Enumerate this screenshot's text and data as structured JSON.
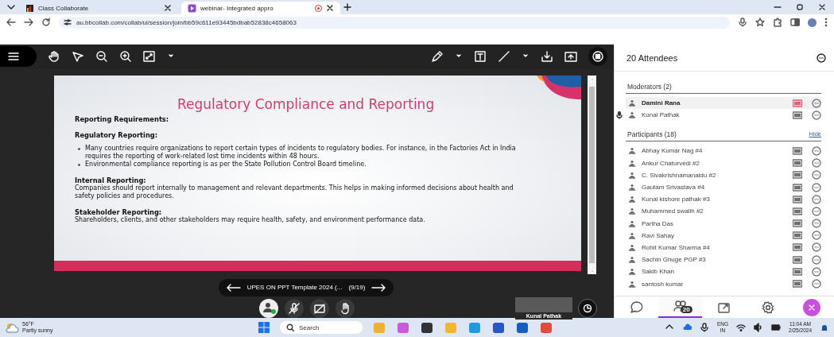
{
  "browser": {
    "tabs": [
      {
        "title": "Class Collaborate",
        "selected": false,
        "recording": false
      },
      {
        "title": "webinar- Integrated appro",
        "selected": true,
        "recording": true
      }
    ],
    "url": "au.bbcollab.com/collab/ui/session/join/bb59c611e93445bdbab52838c4658063"
  },
  "slide": {
    "title": "Regulatory Compliance and Reporting",
    "blocks": [
      {
        "kind": "heading",
        "text": "Reporting Requirements:"
      },
      {
        "kind": "heading",
        "text": "Regulatory Reporting:"
      },
      {
        "kind": "bullet",
        "text": "Many countries require organizations to report certain types of incidents to regulatory bodies. For instance, in the Factories Act in India requires the reporting of work-related lost time incidents within 48 hours."
      },
      {
        "kind": "bullet",
        "text": "Environmental compliance reporting is as per the State Pollution Control Board timeline."
      },
      {
        "kind": "heading",
        "text": "Internal Reporting:"
      },
      {
        "kind": "paragraph",
        "text": "Companies should report internally to management and relevant departments. This helps in making informed decisions about health and safety policies and procedures."
      },
      {
        "kind": "heading",
        "text": "Stakeholder Reporting:"
      },
      {
        "kind": "paragraph",
        "text": "Shareholders, clients, and other stakeholders may require health, safety, and environment performance data."
      }
    ]
  },
  "slide_nav": {
    "file": "UPES ON PPT Template 2024 (...",
    "page": "(9/19)"
  },
  "video_tile": {
    "name": "Kunal Pathak"
  },
  "attendees": {
    "title": "20 Attendees",
    "groups": [
      {
        "label": "Moderators (2)",
        "people": [
          {
            "name": "Damini Rana",
            "highlighted": true,
            "talking": false,
            "color": "#e06070"
          },
          {
            "name": "Kunal Pathak",
            "highlighted": false,
            "talking": true,
            "color": "#707070"
          }
        ]
      },
      {
        "label": "Participants (18)",
        "action": "Hide",
        "people": [
          {
            "name": "Abhay Kumar Nag #4",
            "highlighted": false,
            "talking": false,
            "color": "#707070"
          },
          {
            "name": "Ankur Chaturvedi #2",
            "highlighted": false,
            "talking": false,
            "color": "#707070"
          },
          {
            "name": "C. Sivakrishnamanaidu #2",
            "highlighted": false,
            "talking": false,
            "color": "#707070"
          },
          {
            "name": "Gautam Srivastava #4",
            "highlighted": false,
            "talking": false,
            "color": "#707070"
          },
          {
            "name": "Kunal kishore pathak #3",
            "highlighted": false,
            "talking": false,
            "color": "#707070"
          },
          {
            "name": "Muhammed swalih #2",
            "highlighted": false,
            "talking": false,
            "color": "#707070"
          },
          {
            "name": "Partha Das",
            "highlighted": false,
            "talking": false,
            "color": "#707070"
          },
          {
            "name": "Ravi Sahay",
            "highlighted": false,
            "talking": false,
            "color": "#707070"
          },
          {
            "name": "Rohit Kumar Sharma #4",
            "highlighted": false,
            "talking": false,
            "color": "#707070"
          },
          {
            "name": "Sachin Ghuge PGP #3",
            "highlighted": false,
            "talking": false,
            "color": "#707070"
          },
          {
            "name": "Sakib Khan",
            "highlighted": false,
            "talking": false,
            "color": "#707070"
          },
          {
            "name": "santosh kumar",
            "highlighted": false,
            "talking": false,
            "color": "#707070"
          }
        ]
      }
    ]
  },
  "panel_tabs": [
    {
      "kind": "chat",
      "selected": false
    },
    {
      "kind": "attendees",
      "selected": true,
      "badge": "20"
    },
    {
      "kind": "share",
      "selected": false
    },
    {
      "kind": "settings",
      "selected": false
    },
    {
      "kind": "close",
      "selected": false
    }
  ],
  "taskbar": {
    "temperature": "56°F",
    "weather": "Partly sunny",
    "search": {
      "placeholder": "Search"
    },
    "language": "ENG",
    "region": "IN",
    "time": "11:04 AM",
    "date": "2/25/2024"
  }
}
